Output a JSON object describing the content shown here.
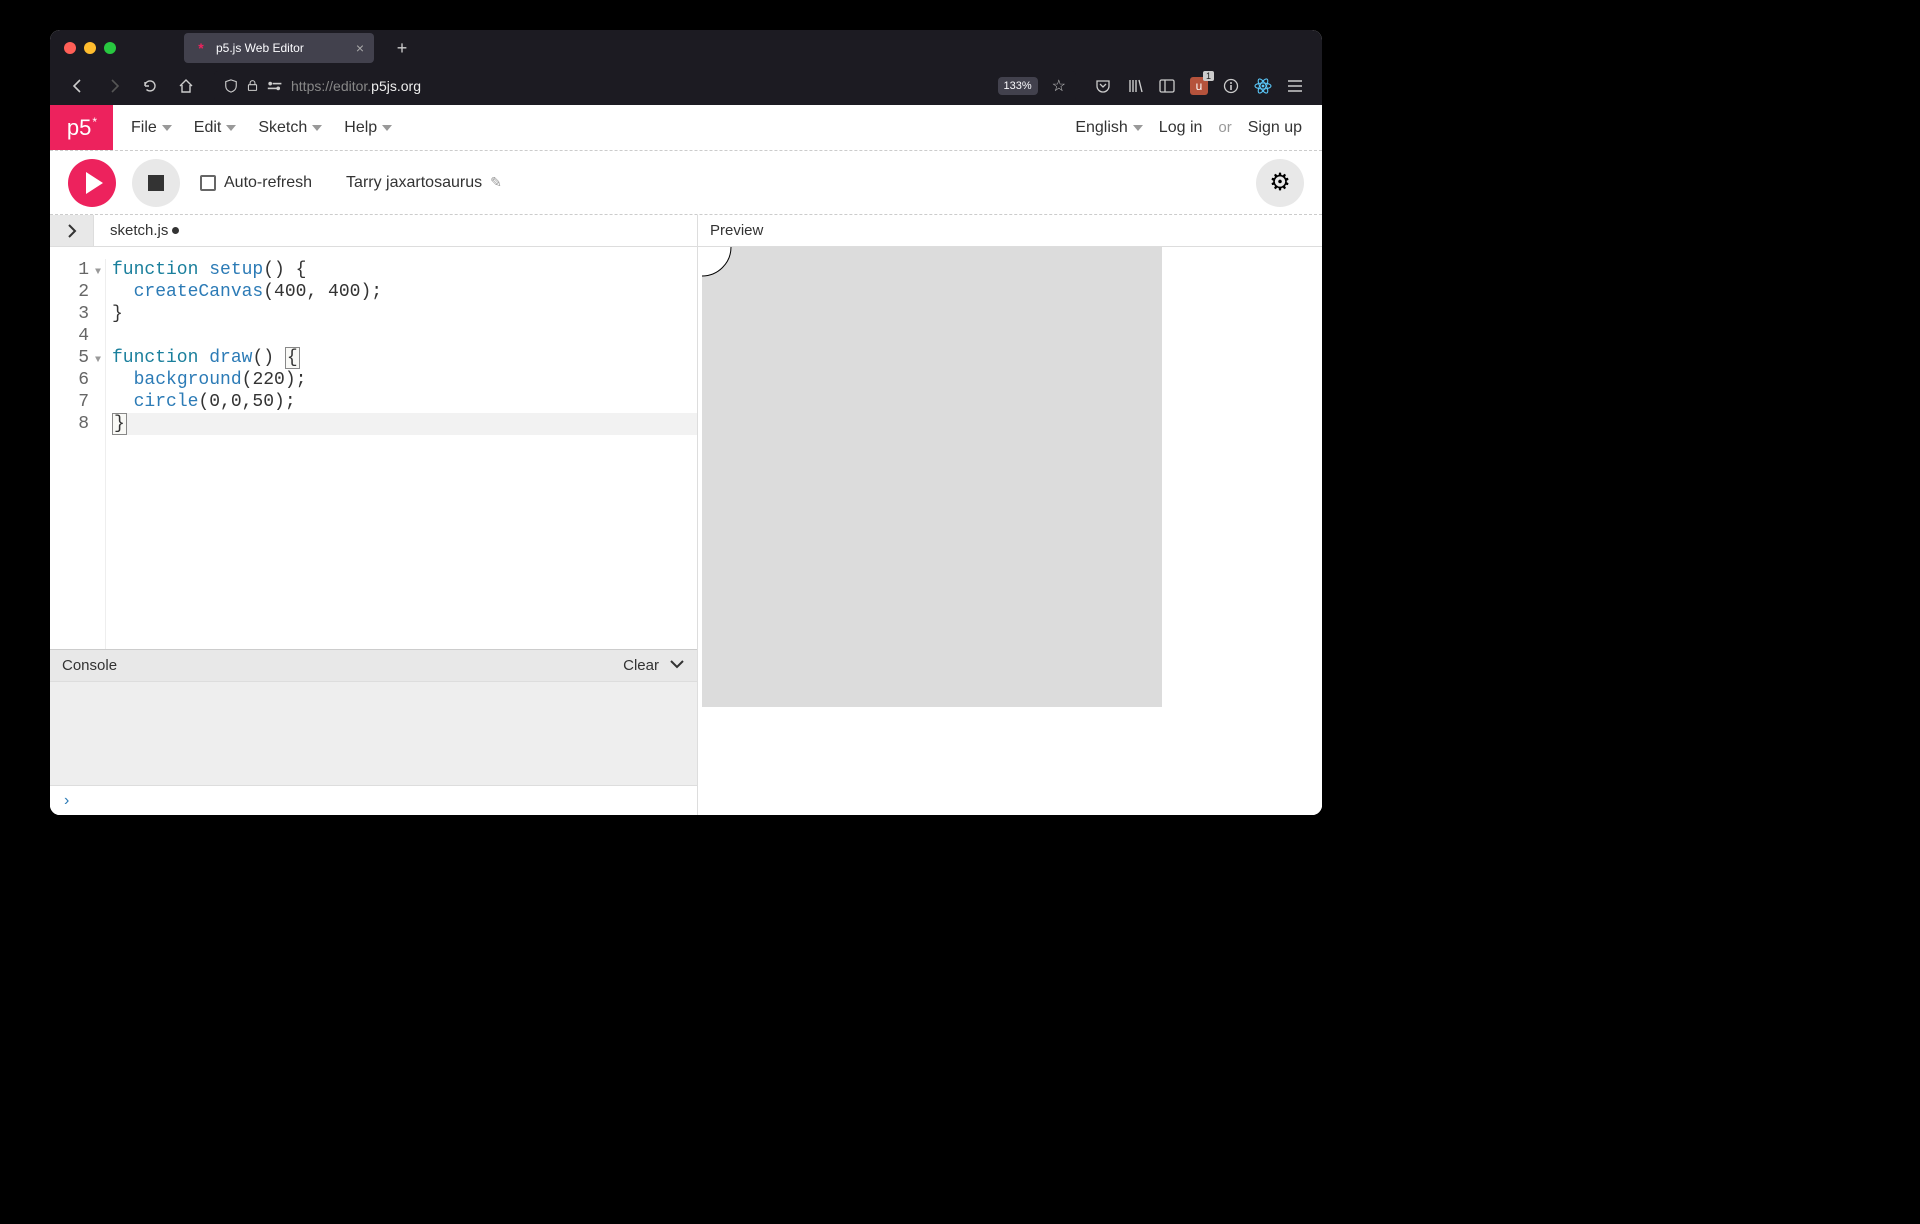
{
  "browser": {
    "tab_title": "p5.js Web Editor",
    "url_prefix": "https://",
    "url_mid": "editor.",
    "url_domain": "p5js.org",
    "zoom": "133%",
    "ext_badge": "1"
  },
  "menubar": {
    "logo": "p5",
    "items": [
      "File",
      "Edit",
      "Sketch",
      "Help"
    ],
    "language": "English",
    "login": "Log in",
    "or": "or",
    "signup": "Sign up"
  },
  "toolbar": {
    "auto_refresh": "Auto-refresh",
    "sketch_name": "Tarry jaxartosaurus"
  },
  "editor": {
    "filename": "sketch.js",
    "lines": [
      {
        "n": 1,
        "fold": true,
        "tokens": [
          [
            "kw",
            "function "
          ],
          [
            "fn",
            "setup"
          ],
          [
            "",
            "() {"
          ]
        ]
      },
      {
        "n": 2,
        "tokens": [
          [
            "",
            "  "
          ],
          [
            "fn",
            "createCanvas"
          ],
          [
            "",
            "(400, 400);"
          ]
        ]
      },
      {
        "n": 3,
        "tokens": [
          [
            "",
            "}"
          ]
        ]
      },
      {
        "n": 4,
        "tokens": [
          [
            "",
            ""
          ]
        ]
      },
      {
        "n": 5,
        "fold": true,
        "tokens": [
          [
            "kw",
            "function "
          ],
          [
            "fn",
            "draw"
          ],
          [
            "",
            "() "
          ],
          [
            "br",
            "{"
          ]
        ]
      },
      {
        "n": 6,
        "tokens": [
          [
            "",
            "  "
          ],
          [
            "fn",
            "background"
          ],
          [
            "",
            "(220);"
          ]
        ]
      },
      {
        "n": 7,
        "tokens": [
          [
            "",
            "  "
          ],
          [
            "fn",
            "circle"
          ],
          [
            "",
            "(0,0,50);"
          ]
        ]
      },
      {
        "n": 8,
        "hl": true,
        "tokens": [
          [
            "br",
            "}"
          ]
        ]
      }
    ]
  },
  "console": {
    "label": "Console",
    "clear": "Clear"
  },
  "preview": {
    "label": "Preview"
  }
}
